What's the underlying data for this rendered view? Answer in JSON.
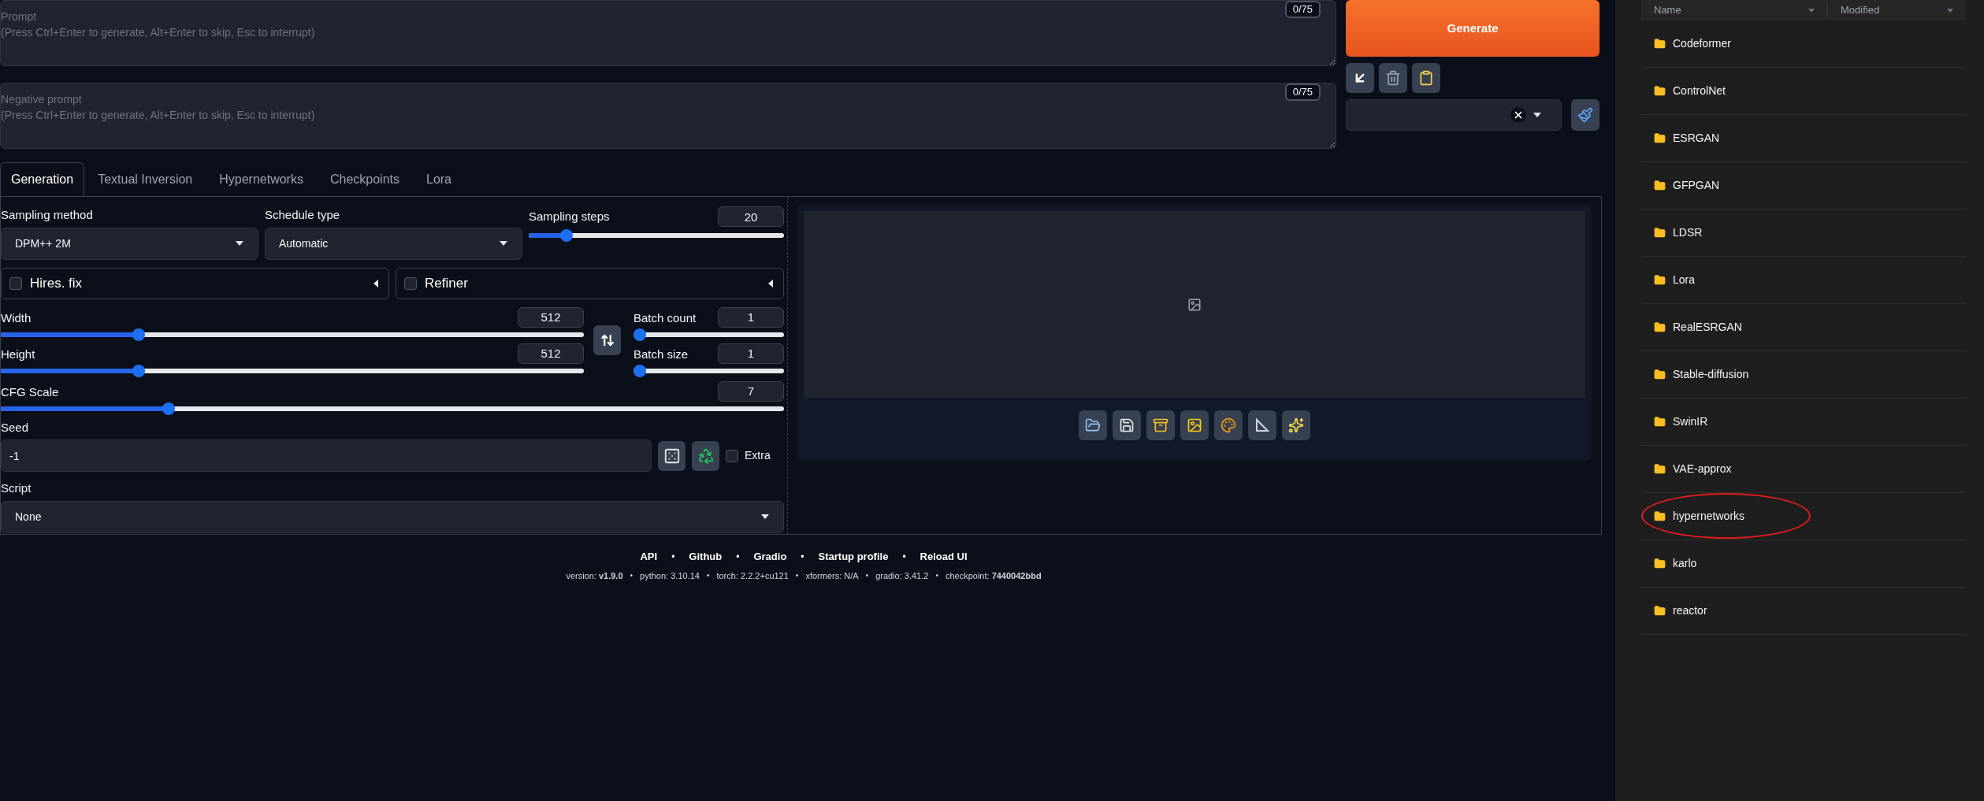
{
  "prompt": {
    "placeholder": "Prompt\n(Press Ctrl+Enter to generate, Alt+Enter to skip, Esc to interrupt)",
    "counter": "0/75"
  },
  "negative_prompt": {
    "placeholder": "Negative prompt\n(Press Ctrl+Enter to generate, Alt+Enter to skip, Esc to interrupt)",
    "counter": "0/75"
  },
  "generate_button": "Generate",
  "tabs": [
    {
      "label": "Generation",
      "selected": true
    },
    {
      "label": "Textual Inversion",
      "selected": false
    },
    {
      "label": "Hypernetworks",
      "selected": false
    },
    {
      "label": "Checkpoints",
      "selected": false
    },
    {
      "label": "Lora",
      "selected": false
    }
  ],
  "sampling_method": {
    "label": "Sampling method",
    "value": "DPM++ 2M"
  },
  "schedule_type": {
    "label": "Schedule type",
    "value": "Automatic"
  },
  "sampling_steps": {
    "label": "Sampling steps",
    "value": "20",
    "level": 0.13
  },
  "accordions": [
    {
      "label": "Hires. fix",
      "checked": false
    },
    {
      "label": "Refiner",
      "checked": false
    }
  ],
  "width": {
    "label": "Width",
    "value": "512",
    "level": 0.23
  },
  "height": {
    "label": "Height",
    "value": "512",
    "level": 0.23
  },
  "batch_count": {
    "label": "Batch count",
    "value": "1",
    "level": 0
  },
  "batch_size": {
    "label": "Batch size",
    "value": "1",
    "level": 0
  },
  "cfg_scale": {
    "label": "CFG Scale",
    "value": "7",
    "level": 0.21
  },
  "seed": {
    "label": "Seed",
    "value": "-1"
  },
  "extra": {
    "label": "Extra",
    "checked": false
  },
  "script": {
    "label": "Script",
    "value": "None"
  },
  "footer": {
    "separator": "•",
    "links": [
      "API",
      "Github",
      "Gradio",
      "Startup profile",
      "Reload UI"
    ],
    "info": [
      "version: **v1.9.0**",
      "python: 3.10.14",
      "torch: 2.2.2+cu121",
      "xformers: N/A",
      "gradio: 3.41.2",
      "checkpoint: **7440042bbd**"
    ]
  },
  "file_browser": {
    "columns": [
      "Name",
      "Modified"
    ],
    "items": [
      {
        "name": "Codeformer",
        "circled": false
      },
      {
        "name": "ControlNet",
        "circled": false
      },
      {
        "name": "ESRGAN",
        "circled": false
      },
      {
        "name": "GFPGAN",
        "circled": false
      },
      {
        "name": "LDSR",
        "circled": false
      },
      {
        "name": "Lora",
        "circled": false
      },
      {
        "name": "RealESRGAN",
        "circled": false
      },
      {
        "name": "Stable-diffusion",
        "circled": false
      },
      {
        "name": "SwinIR",
        "circled": false
      },
      {
        "name": "VAE-approx",
        "circled": false
      },
      {
        "name": "hypernetworks",
        "circled": true
      },
      {
        "name": "karlo",
        "circled": false
      },
      {
        "name": "reactor",
        "circled": false
      }
    ]
  }
}
